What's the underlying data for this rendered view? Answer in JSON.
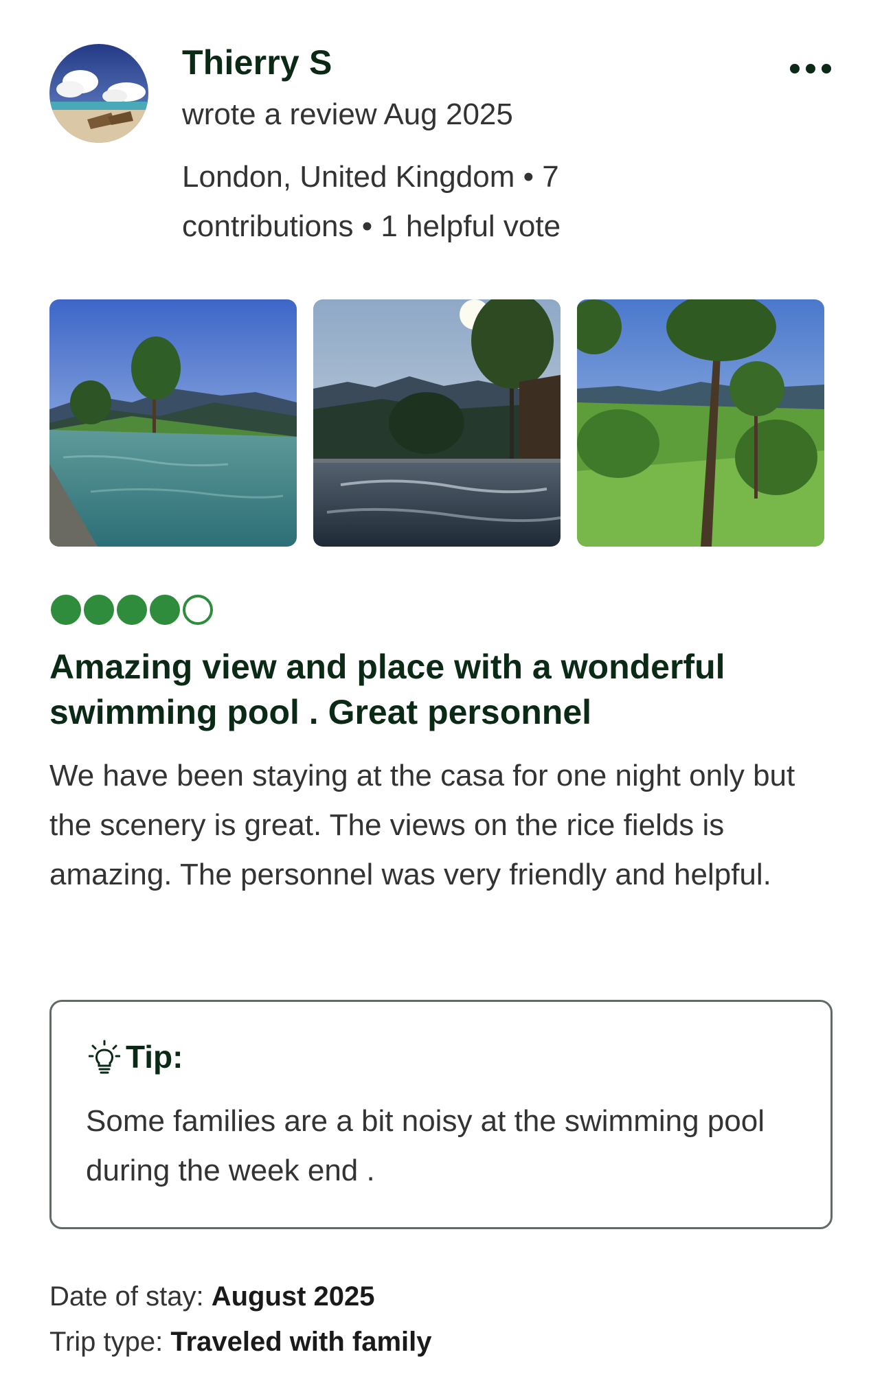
{
  "reviewer": {
    "name": "Thierry S",
    "meta": "wrote a review Aug 2025",
    "location_line": "London, United Kingdom • 7 contributions • 1 helpful vote",
    "avatar_icon": "beach-avatar"
  },
  "more_icon": "more-horizontal-icon",
  "photos": [
    {
      "subject": "infinity pool with tree and mountains"
    },
    {
      "subject": "pool with sun and mountain view"
    },
    {
      "subject": "green hillside with trees"
    }
  ],
  "rating": {
    "value": 4,
    "max": 5
  },
  "review": {
    "title": "Amazing view and place with a wonderful swimming pool . Great personnel",
    "body": "We have been staying at the casa for one night only but the scenery is great. The views on the rice fields is amazing. The personnel was very friendly and helpful."
  },
  "tip": {
    "label": "Tip:",
    "text": "Some families are a bit noisy at the swimming pool during the week end ."
  },
  "stay": {
    "date_label": "Date of stay:",
    "date_value": "August 2025",
    "trip_label": "Trip type:",
    "trip_value": "Traveled with family"
  },
  "colors": {
    "brand_green": "#2f8c3c",
    "title_dark": "#0b2a15"
  }
}
